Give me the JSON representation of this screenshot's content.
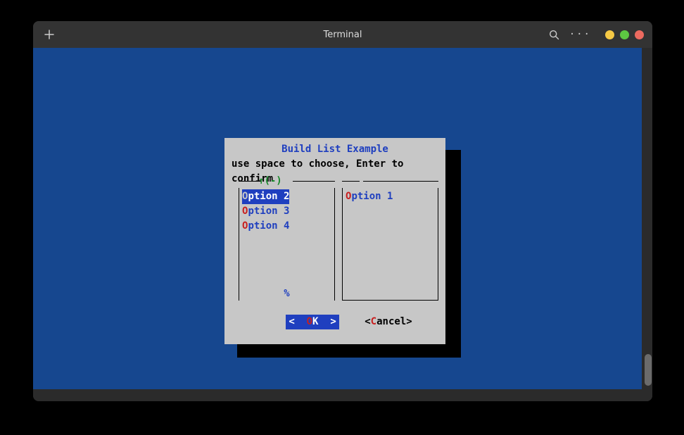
{
  "window": {
    "title": "Terminal"
  },
  "dialog": {
    "title": "Build List Example",
    "subtitle": "use space to choose, Enter to confirm",
    "left_header_arrow": "↑",
    "left_header_indicator": "(-)",
    "left_footer": "%",
    "left_items": [
      {
        "hot": "O",
        "rest": "ption 2",
        "selected": true
      },
      {
        "hot": "O",
        "rest": "ption 3",
        "selected": false
      },
      {
        "hot": "O",
        "rest": "ption 4",
        "selected": false
      }
    ],
    "right_items": [
      {
        "hot": "O",
        "rest": "ption 1"
      }
    ],
    "buttons": {
      "ok": {
        "left": "<",
        "hot": "O",
        "rest": "K",
        "right": ">"
      },
      "cancel": {
        "left": "<",
        "hot": "C",
        "rest": "ancel",
        "right": ">"
      }
    }
  }
}
